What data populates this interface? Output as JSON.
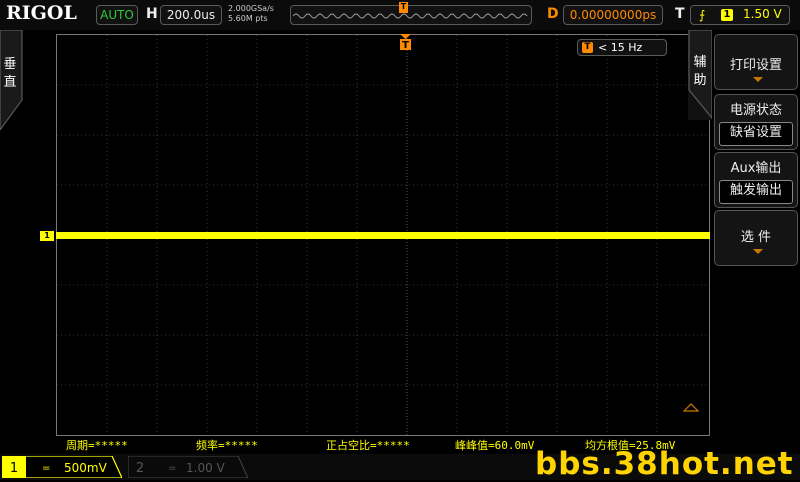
{
  "brand": "RIGOL",
  "top": {
    "run_mode": "AUTO",
    "h_label": "H",
    "timebase": "200.0us",
    "sample_rate": "2.000GSa/s",
    "memory_depth": "5.60M pts",
    "trig_pos_badge": "T",
    "delay_label": "D",
    "delay_value": "0.00000000ps",
    "trig_label": "T",
    "trig_channel": "1",
    "trig_level": "1.50 V"
  },
  "left_tab": {
    "label_1": "垂",
    "label_2": "直"
  },
  "aux_tab": {
    "label_1": "辅",
    "label_2": "助"
  },
  "freq_counter": {
    "badge": "T",
    "value": "< 15 Hz"
  },
  "trigger_marker_text": "T",
  "ch1_marker": "1",
  "measurements": {
    "period": "周期=*****",
    "frequency": "频率=*****",
    "duty": "正占空比=*****",
    "vpp": "峰峰值=60.0mV",
    "vrms": "均方根值=25.8mV"
  },
  "menu": {
    "print_setup": "打印设置",
    "power_status": "电源状态",
    "power_status_value": "缺省设置",
    "aux_output": "Aux输出",
    "aux_output_value": "触发输出",
    "options": "选 件"
  },
  "bottom": {
    "ch1_num": "1",
    "ch1_coupling": "=",
    "ch1_scale": "500mV",
    "ch2_num": "2",
    "ch2_coupling": "=",
    "ch2_scale": "1.00 V"
  },
  "watermark": "bbs.38hot.net",
  "colors": {
    "ch1": "#ffff00",
    "trigger": "#ff8a00",
    "run_mode": "#32c83c"
  }
}
